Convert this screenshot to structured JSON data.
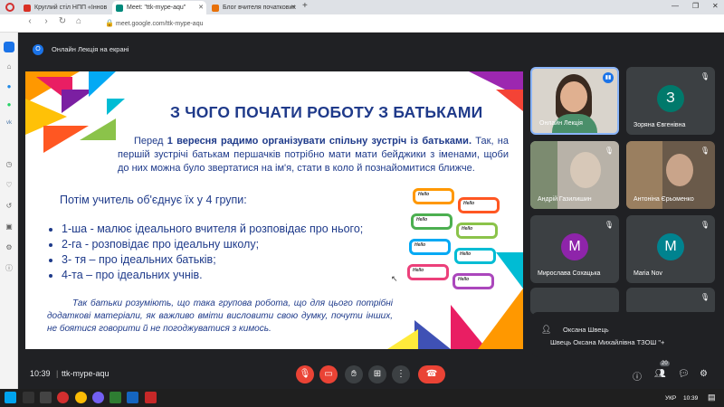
{
  "browser": {
    "tabs": [
      {
        "label": "Круглий стіл НПП «Іннов",
        "color": "#d93025"
      },
      {
        "label": "Meet: \"ttk-mype-aqu\"",
        "color": "#00897b"
      },
      {
        "label": "Блог вчителя початкових",
        "color": "#e8710a"
      }
    ],
    "url": "meet.google.com/ttk-mype-aqu"
  },
  "meet": {
    "presenter_initial": "О",
    "presenting_label": "Онлайн Лекція на екрані",
    "time": "10:39",
    "meeting_code": "ttk-mype-aqu",
    "participant_count": "20"
  },
  "slide": {
    "title": "З ЧОГО ПОЧАТИ РОБОТУ З БАТЬКАМИ",
    "p1_lead": "Перед ",
    "p1_bold": "1 вересня радимо організувати спільну зустріч із батьками.",
    "p1_rest": " Так, на першій зустрічі батькам першачків потрібно мати мати бейджики з іменами, щоби до них можна було звертатися на ім'я, стати в коло й познайомитися ближче.",
    "p2": "Потім учитель об'єднує їх у 4 групи:",
    "groups": [
      "1-ша - малює ідеального вчителя й розповідає про нього;",
      "2-га - розповідає про ідеальну школу;",
      "3- тя – про ідеальних батьків;",
      "4-та – про ідеальних учнів."
    ],
    "p3": "Так батьки розуміють, що така групова робота, що для цього потрібні додаткові матеріали, як важливо вміти висловити свою думку, почути інших, не боятися говорити й не погоджуватися з кимось.",
    "badge_text": "Hello"
  },
  "participants": [
    {
      "name": "Онлайн Лекція",
      "type": "video",
      "active": true
    },
    {
      "name": "Зоряна Євгенівна",
      "initial": "З",
      "color": "#00796b"
    },
    {
      "name": "Андрій Газилишин",
      "type": "video"
    },
    {
      "name": "Антоніна Єрьоменко",
      "type": "video"
    },
    {
      "name": "Мирослава Сохацька",
      "initial": "М",
      "color": "#8e24aa"
    },
    {
      "name": "Maria Nov",
      "initial": "M",
      "color": "#00838f"
    }
  ],
  "popup": {
    "title": "Оксана Швець",
    "subtitle": "Швець Оксана Михайлівна ТЗОШ \"+"
  },
  "taskbar": {
    "lang": "УКР",
    "clock": "10:39"
  }
}
